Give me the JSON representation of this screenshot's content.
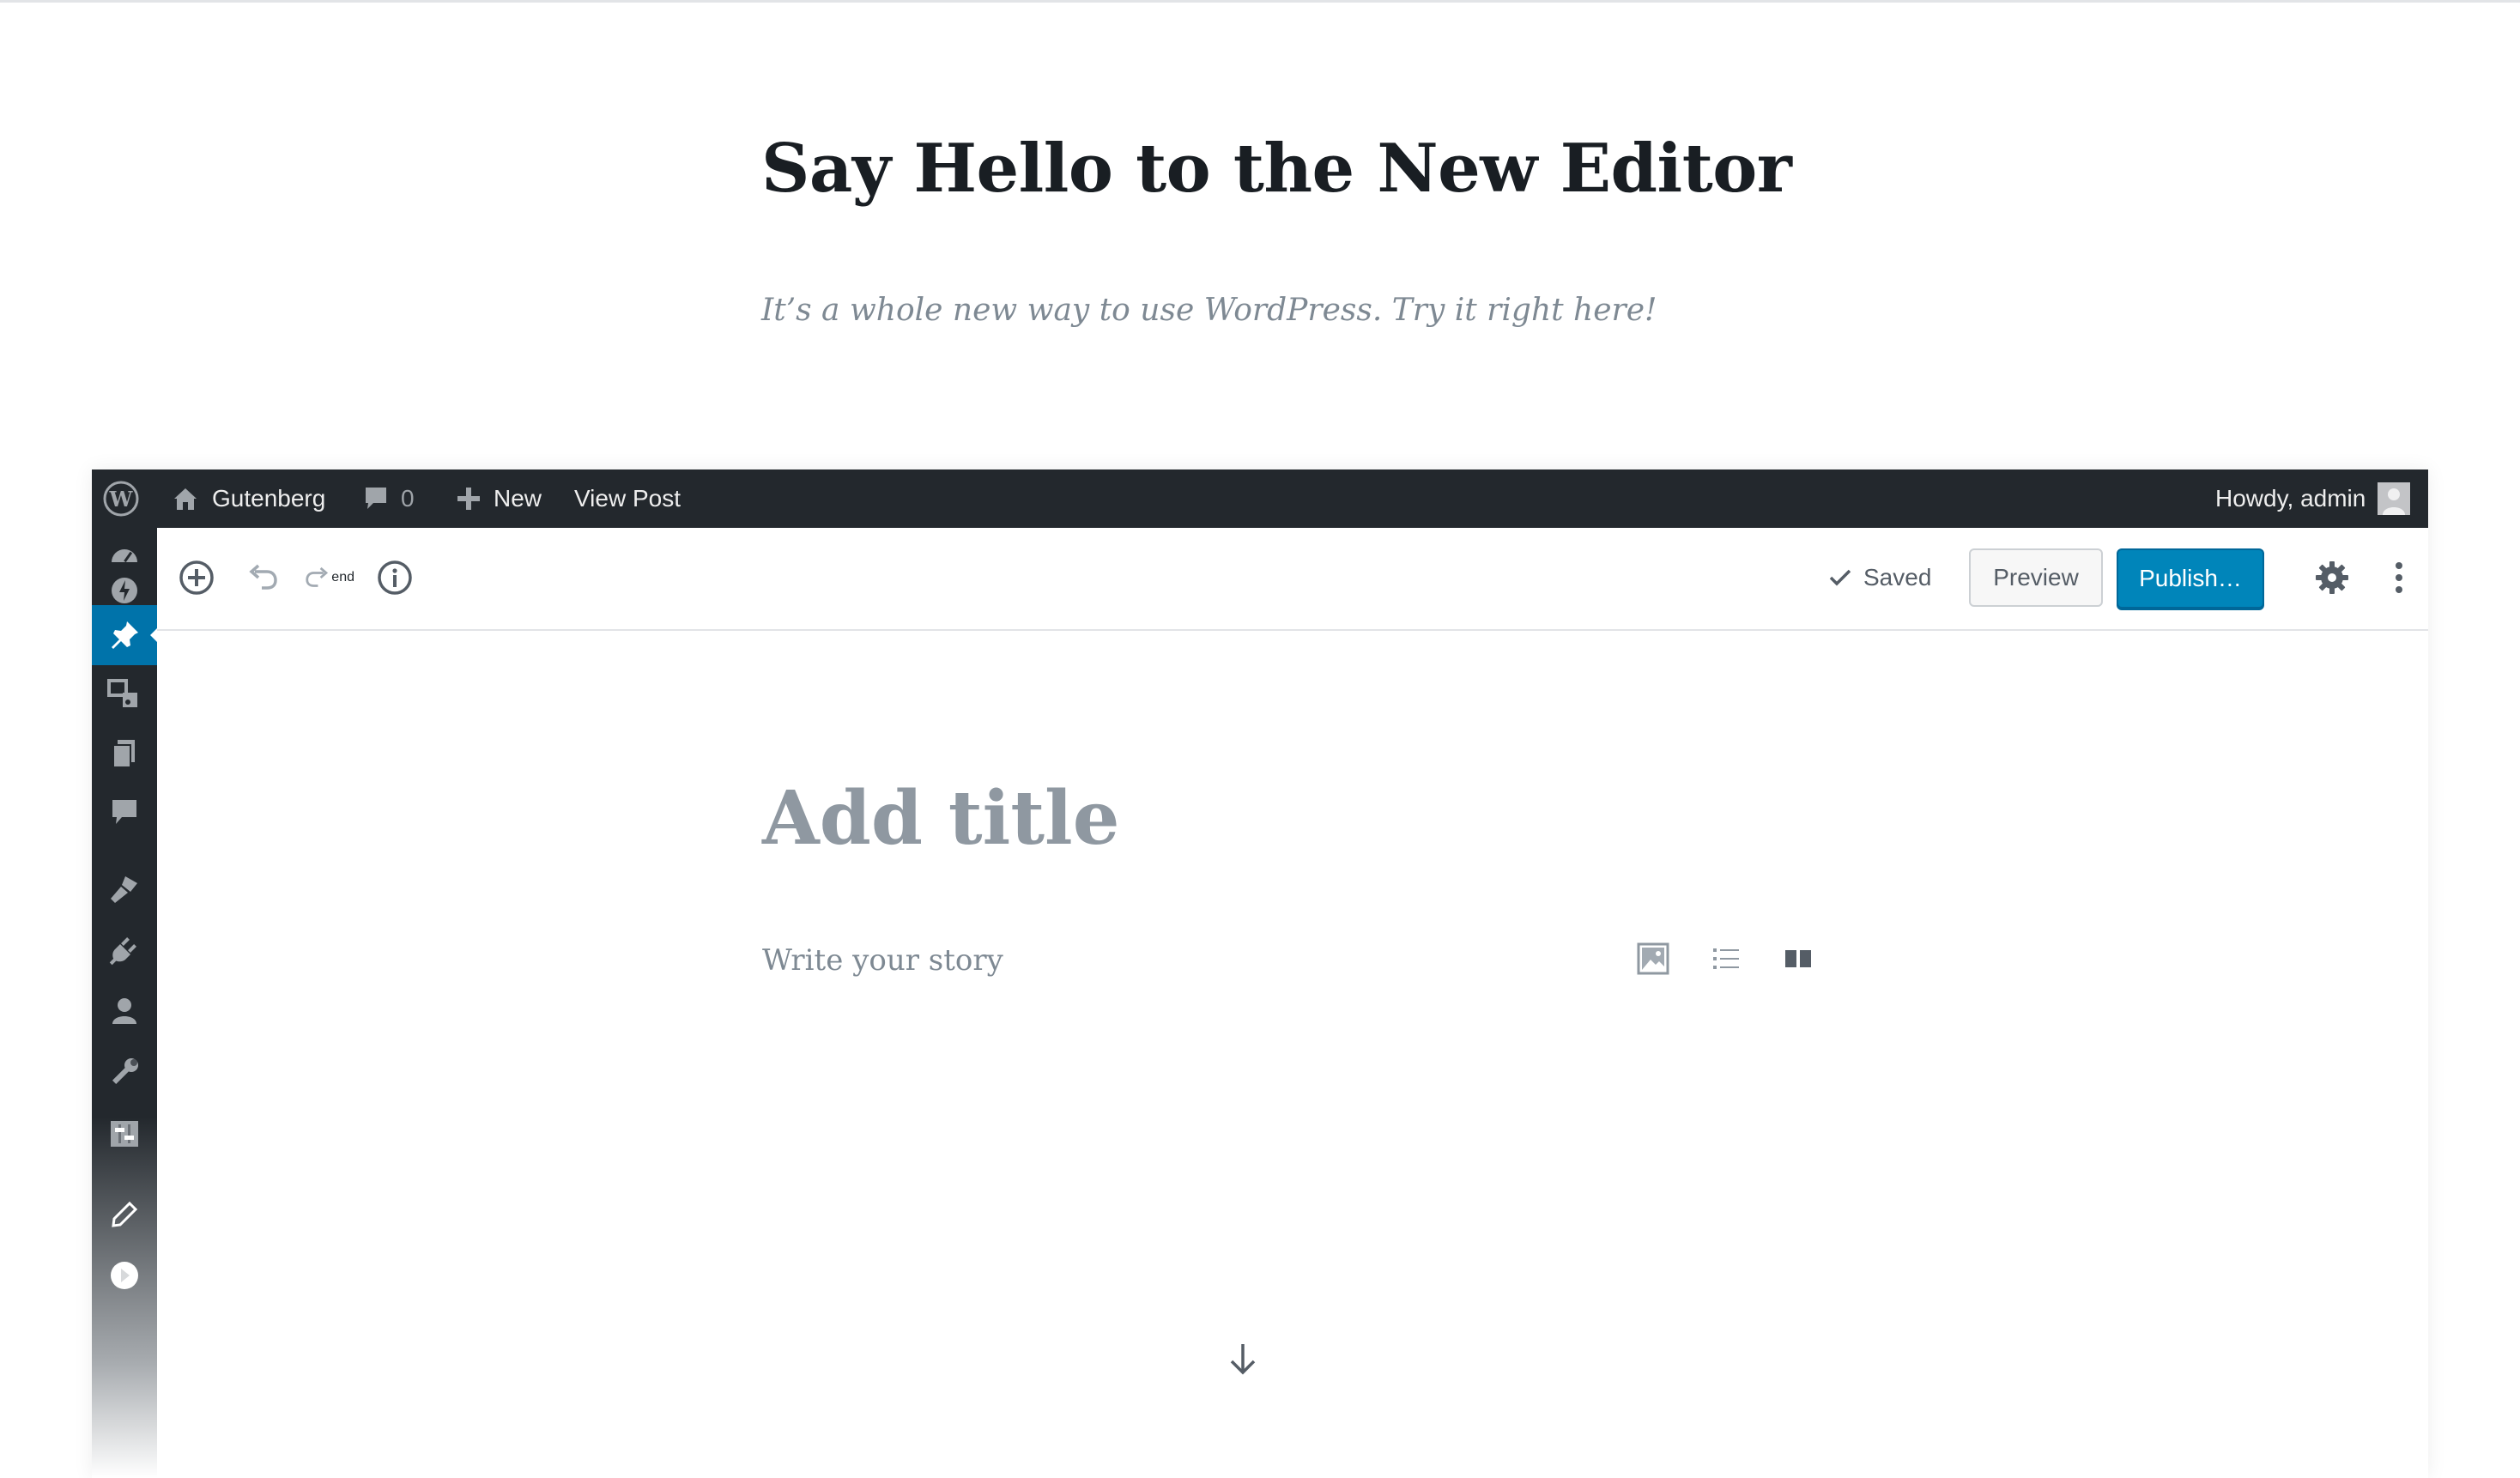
{
  "hero": {
    "title": "Say Hello to the New Editor",
    "subtitle": "It’s a whole new way to use WordPress. Try it right here!"
  },
  "admin_bar": {
    "wp_logo_icon": "wordpress-logo-icon",
    "site_name": "Gutenberg",
    "comments_count": "0",
    "new_label": "New",
    "view_post_label": "View Post",
    "greeting": "Howdy, admin"
  },
  "admin_menu": {
    "items": [
      "dashboard",
      "jetpack",
      "posts",
      "media",
      "pages",
      "comments",
      "appearance",
      "plugins",
      "users",
      "tools",
      "settings",
      "gutenberg",
      "collapse"
    ],
    "active": "posts",
    "active_color": "#0073aa"
  },
  "toolbar": {
    "saved_label": "Saved",
    "preview_label": "Preview",
    "publish_label": "Publish…",
    "publish_color": "#0085ba"
  },
  "editor": {
    "title_placeholder": "Add title",
    "body_placeholder": "Write your story",
    "quick_inserters": [
      "image-icon",
      "list-icon",
      "columns-icon"
    ]
  },
  "colors": {
    "admin_bar_bg": "#23282d",
    "accent": "#0073aa"
  }
}
